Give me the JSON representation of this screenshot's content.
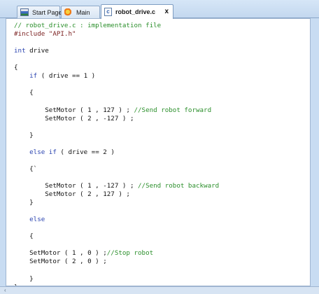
{
  "tabs": [
    {
      "label": "Start Page",
      "icon": "start-page-icon",
      "active": false
    },
    {
      "label": "Main",
      "icon": "main-icon",
      "active": false
    },
    {
      "label": "robot_drive.c",
      "icon": "c-file-icon",
      "active": true
    }
  ],
  "editor": {
    "lines": [
      {
        "text": "// robot_drive.c : implementation file",
        "kind": "comment"
      },
      {
        "text": "#include \"API.h\"",
        "kind": "preproc"
      },
      {
        "text": "",
        "kind": "plain"
      },
      {
        "text": "int drive",
        "kind": "keyword_mixed"
      },
      {
        "text": "",
        "kind": "plain"
      },
      {
        "text": "{",
        "kind": "plain"
      },
      {
        "text": "    if ( drive == 1 )",
        "kind": "keyword_mixed_if"
      },
      {
        "text": "",
        "kind": "plain"
      },
      {
        "text": "    {",
        "kind": "plain"
      },
      {
        "text": "",
        "kind": "plain"
      },
      {
        "text": "        SetMotor ( 1 , 127 ) ; //Send robot forward",
        "kind": "mixed_comment"
      },
      {
        "text": "        SetMotor ( 2 , -127 ) ;",
        "kind": "plain"
      },
      {
        "text": "",
        "kind": "plain"
      },
      {
        "text": "    }",
        "kind": "plain"
      },
      {
        "text": "",
        "kind": "plain"
      },
      {
        "text": "    else if ( drive == 2 )",
        "kind": "keyword_mixed_elseif"
      },
      {
        "text": "",
        "kind": "plain"
      },
      {
        "text": "    {`",
        "kind": "plain"
      },
      {
        "text": "",
        "kind": "plain"
      },
      {
        "text": "        SetMotor ( 1 , -127 ) ; //Send robot backward",
        "kind": "mixed_comment"
      },
      {
        "text": "        SetMotor ( 2 , 127 ) ;",
        "kind": "plain"
      },
      {
        "text": "    }",
        "kind": "plain"
      },
      {
        "text": "",
        "kind": "plain"
      },
      {
        "text": "    else",
        "kind": "keyword_only"
      },
      {
        "text": "",
        "kind": "plain"
      },
      {
        "text": "    {",
        "kind": "plain"
      },
      {
        "text": "",
        "kind": "plain"
      },
      {
        "text": "    SetMotor ( 1 , 0 ) ;//Stop robot",
        "kind": "mixed_comment"
      },
      {
        "text": "    SetMotor ( 2 , 0 ) ;",
        "kind": "plain"
      },
      {
        "text": "",
        "kind": "plain"
      },
      {
        "text": "    }",
        "kind": "plain"
      },
      {
        "text": "}",
        "kind": "plain"
      }
    ]
  }
}
